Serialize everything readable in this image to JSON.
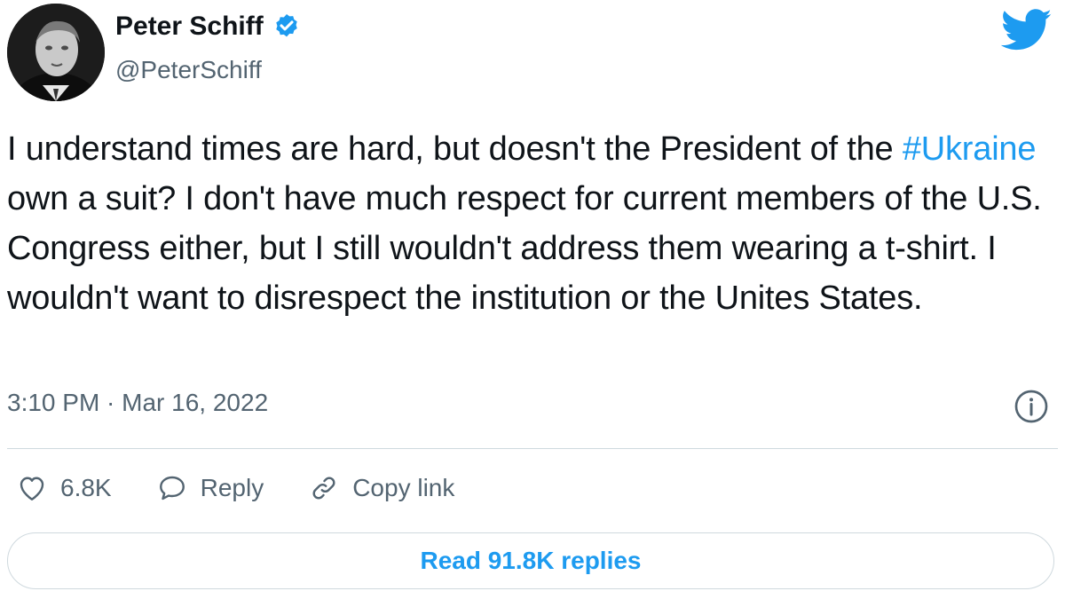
{
  "author": {
    "display_name": "Peter Schiff",
    "handle": "@PeterSchiff",
    "verified": true
  },
  "tweet": {
    "text_before_hashtag": "I understand times are hard, but doesn't the President of the ",
    "hashtag": "#Ukraine",
    "text_after_hashtag": " own a suit? I don't have much respect for current members of the U.S. Congress either, but I still wouldn't address them wearing a t-shirt. I wouldn't want to disrespect the institution or the Unites States.",
    "timestamp": "3:10 PM · Mar 16, 2022"
  },
  "actions": {
    "like_count": "6.8K",
    "reply_label": "Reply",
    "copy_link_label": "Copy link"
  },
  "footer": {
    "read_replies_label": "Read 91.8K replies"
  },
  "icons": {
    "brand": "twitter-bird-icon",
    "verified": "verified-badge-icon",
    "info": "info-icon",
    "like": "heart-icon",
    "reply": "speech-bubble-icon",
    "copy_link": "link-icon"
  },
  "colors": {
    "accent": "#1d9bf0",
    "text_primary": "#0f1419",
    "text_secondary": "#536471",
    "border": "#cfd9de"
  }
}
